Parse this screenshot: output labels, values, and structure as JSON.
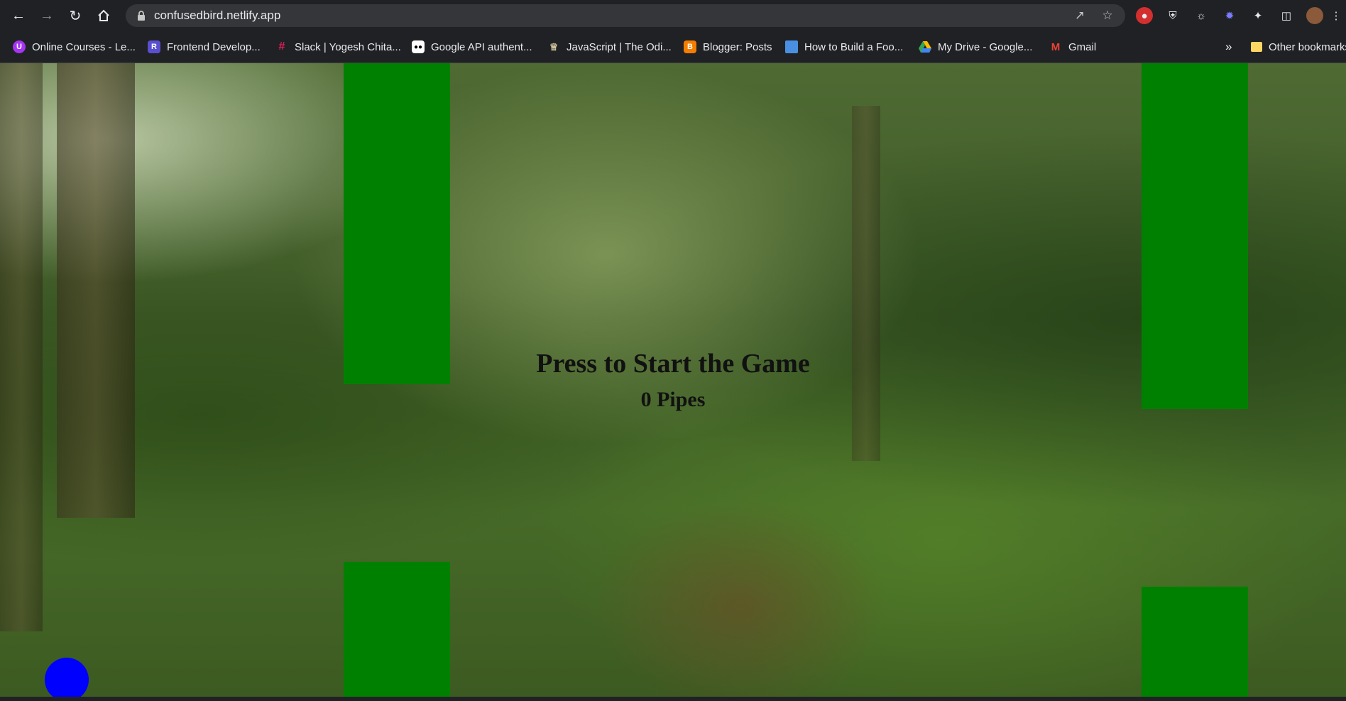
{
  "browser": {
    "url": "confusedbird.netlify.app",
    "nav": {
      "back_icon": "arrow-left-icon",
      "forward_icon": "arrow-right-icon",
      "reload_icon": "reload-icon",
      "home_icon": "home-icon"
    },
    "bookmarks": [
      {
        "label": "Online Courses - Le...",
        "icon": "udemy-icon",
        "color": "#a435f0"
      },
      {
        "label": "Frontend Develop...",
        "icon": "r-icon",
        "color": "#5a4fcf"
      },
      {
        "label": "Slack | Yogesh Chita...",
        "icon": "slack-icon",
        "color": "#e01e5a"
      },
      {
        "label": "Google API authent...",
        "icon": "medium-icon",
        "color": "#ffffff"
      },
      {
        "label": "JavaScript | The Odi...",
        "icon": "odin-icon",
        "color": "#d6c7a1"
      },
      {
        "label": "Blogger: Posts",
        "icon": "blogger-icon",
        "color": "#f57d00"
      },
      {
        "label": "How to Build a Foo...",
        "icon": "monitor-icon",
        "color": "#4a90e2"
      },
      {
        "label": "My Drive - Google...",
        "icon": "drive-icon",
        "color": "#34a853"
      },
      {
        "label": "Gmail",
        "icon": "gmail-icon",
        "color": "#ea4335"
      }
    ],
    "more_bookmarks": "»",
    "other_bookmarks": "Other bookmarks"
  },
  "game": {
    "title_message": "Press to Start the Game",
    "score_text": "0 Pipes",
    "colors": {
      "pipe": "#008000",
      "bird": "#0000ff"
    }
  }
}
